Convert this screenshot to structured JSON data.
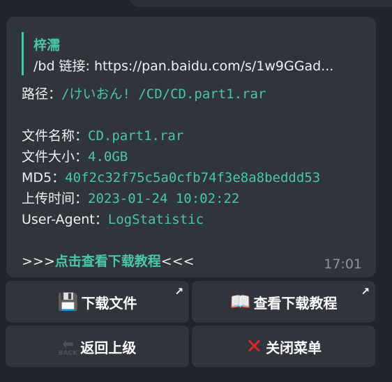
{
  "message": {
    "reply": {
      "sender": "梓濡",
      "text": "/bd 链接: https://pan.baidu.com/s/1w9GGad..."
    },
    "path_label": "路径：",
    "path_value": "/けいおん! /CD/CD.part1.rar",
    "file_name_label": "文件名称：",
    "file_name_value": "CD.part1.rar",
    "file_size_label": "文件大小：",
    "file_size_value": "4.0GB",
    "md5_label": "MD5：",
    "md5_value": "40f2c32f75c5a0cfb74f3e8a8beddd53",
    "upload_time_label": "上传时间：",
    "upload_time_value": "2023-01-24 10:02:22",
    "user_agent_label": "User-Agent：",
    "user_agent_value": "LogStatistic",
    "tutorial_prefix": ">>>",
    "tutorial_link": "点击查看下载教程",
    "tutorial_suffix": "<<<",
    "time": "17:01"
  },
  "keyboard": {
    "download_file": "下载文件",
    "view_tutorial": "查看下载教程",
    "back": "返回上级",
    "back_icon_text": "BACK",
    "close_menu": "关闭菜单"
  },
  "icons": {
    "download": "floppy-disk-icon",
    "tutorial": "open-book-icon",
    "back": "back-arrow-icon",
    "close": "red-x-icon",
    "external": "external-link-arrow-icon"
  },
  "colors": {
    "accent": "#4ac7a7",
    "bubble": "#30353c",
    "background": "#21252b",
    "time": "#8d949c",
    "close_x": "#e0262c"
  }
}
